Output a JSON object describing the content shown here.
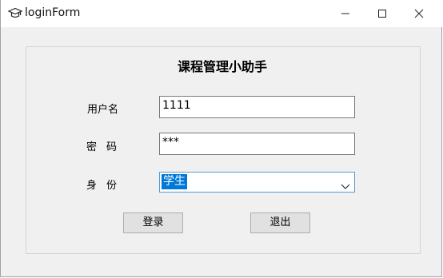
{
  "window": {
    "title": "loginForm",
    "icon": "graduation-cap-icon",
    "controls": {
      "minimize": "minimize-icon",
      "maximize": "maximize-icon",
      "close": "close-icon"
    }
  },
  "form": {
    "heading": "课程管理小助手",
    "username": {
      "label": "用户名",
      "value": "1111"
    },
    "password": {
      "label": "密码",
      "value": "***"
    },
    "role": {
      "label": "身份",
      "selected": "学生"
    },
    "buttons": {
      "login": "登录",
      "exit": "退出"
    }
  },
  "colors": {
    "window_bg": "#f0f0f0",
    "titlebar_bg": "#ffffff",
    "selection": "#0078d7",
    "focus_border": "#5b9bd5",
    "button_bg": "#e1e1e1"
  }
}
